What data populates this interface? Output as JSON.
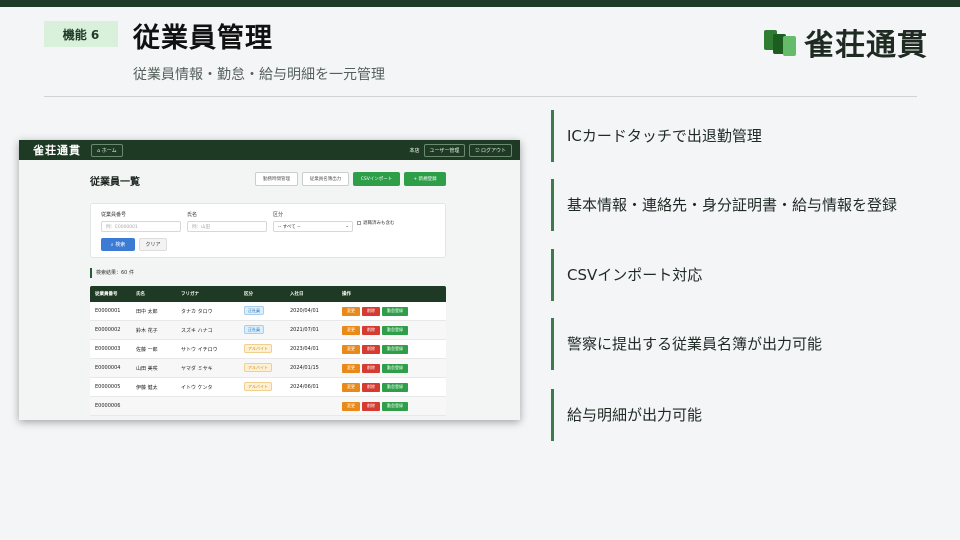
{
  "badge": "機能 6",
  "title": "従業員管理",
  "subtitle": "従業員情報・勤怠・給与明細を一元管理",
  "brand": {
    "name": "雀荘通貫",
    "colors": [
      "#2e7d32",
      "#1b5e20",
      "#66bb6a"
    ]
  },
  "app": {
    "logo": "雀荘通貫",
    "home": "ホーム",
    "store": "本店",
    "user_mgmt": "ユーザー管理",
    "logout": "ログアウト",
    "page_title": "従業員一覧",
    "actions": [
      "勤務時間管理",
      "従業員名簿出力",
      "CSVインポート",
      "+ 新規登録"
    ],
    "search": {
      "id_label": "従業員番号",
      "id_placeholder": "例：E0000001",
      "name_label": "氏名",
      "name_placeholder": "例：山田",
      "type_label": "区分",
      "type_value": "-- すべて --",
      "retired_label": "退職済みも含む",
      "search_btn": "検索",
      "clear_btn": "クリア"
    },
    "result_count": "検索結果：60 件",
    "columns": [
      "従業員番号",
      "氏名",
      "フリガナ",
      "区分",
      "入社日",
      "操作"
    ],
    "row_actions": [
      "変更",
      "削除",
      "勤怠登録"
    ],
    "rows": [
      {
        "id": "E0000001",
        "name": "田中 太郎",
        "kana": "タナカ タロウ",
        "type": "正社員",
        "kind": "reg",
        "date": "2020/04/01"
      },
      {
        "id": "E0000002",
        "name": "鈴木 花子",
        "kana": "スズキ ハナコ",
        "type": "正社員",
        "kind": "reg",
        "date": "2021/07/01"
      },
      {
        "id": "E0000003",
        "name": "佐藤 一郎",
        "kana": "サトウ イチロウ",
        "type": "アルバイト",
        "kind": "part",
        "date": "2023/04/01"
      },
      {
        "id": "E0000004",
        "name": "山田 美咲",
        "kana": "ヤマダ ミサキ",
        "type": "アルバイト",
        "kind": "part",
        "date": "2024/01/15"
      },
      {
        "id": "E0000005",
        "name": "伊藤 健太",
        "kana": "イトウ ケンタ",
        "type": "アルバイト",
        "kind": "part",
        "date": "2024/06/01"
      },
      {
        "id": "E0000006",
        "name": "",
        "kana": "",
        "type": "",
        "kind": "part",
        "date": ""
      }
    ]
  },
  "features": [
    "ICカードタッチで出退勤管理",
    "基本情報・連絡先・身分証明書・給与情報を登録",
    "CSVインポート対応",
    "警察に提出する従業員名簿が出力可能",
    "給与明細が出力可能"
  ]
}
